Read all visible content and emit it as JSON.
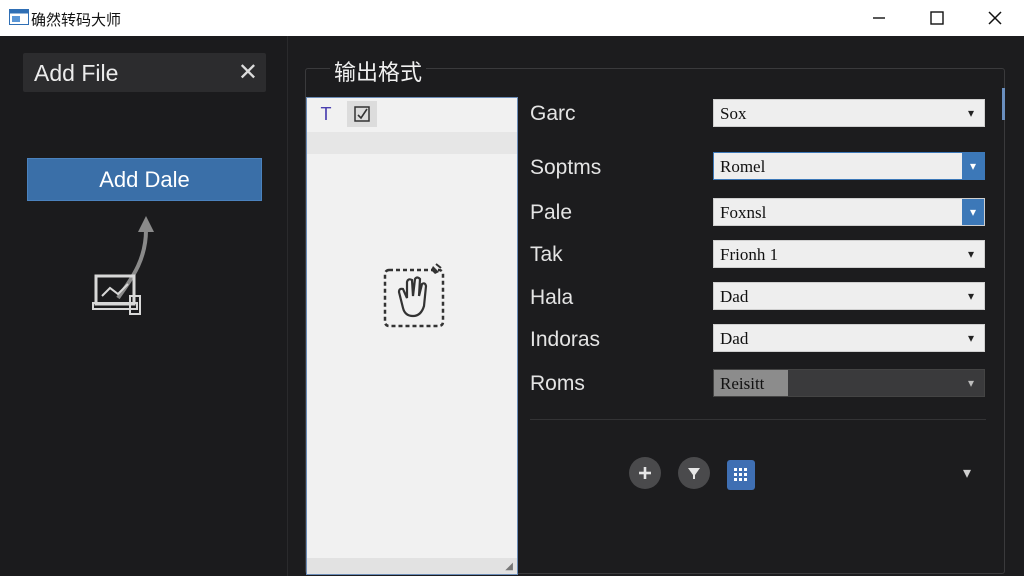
{
  "window": {
    "title": "确然转码大师",
    "icons": {
      "app": "app-window-icon",
      "minimize": "minimize-icon",
      "maximize": "maximize-icon",
      "close": "close-icon"
    }
  },
  "left_pane": {
    "tab_label": "Add File",
    "add_button_label": "Add Dale"
  },
  "main": {
    "section_title": "输出格式",
    "preview_toolbar": {
      "text_tool": "T",
      "check_tool": "checkbox-icon"
    },
    "fields": [
      {
        "label": "Garc",
        "value": "Sox",
        "state": "normal"
      },
      {
        "label": "Soptms",
        "value": "Romel",
        "state": "focused"
      },
      {
        "label": "Pale",
        "value": "Foxnsl",
        "state": "focused-arrow"
      },
      {
        "label": "Tak",
        "value": "Frionh 1",
        "state": "normal"
      },
      {
        "label": "Hala",
        "value": "Dad",
        "state": "normal"
      },
      {
        "label": "Indoras",
        "value": "Dad",
        "state": "normal"
      },
      {
        "label": "Roms",
        "value": "Reisitt",
        "state": "disabled"
      }
    ],
    "actions": [
      "add-icon",
      "filter-icon",
      "grid-document-icon"
    ]
  },
  "colors": {
    "accent": "#3a6fa8",
    "background": "#1c1c1e",
    "titlebar": "#ffffff"
  }
}
